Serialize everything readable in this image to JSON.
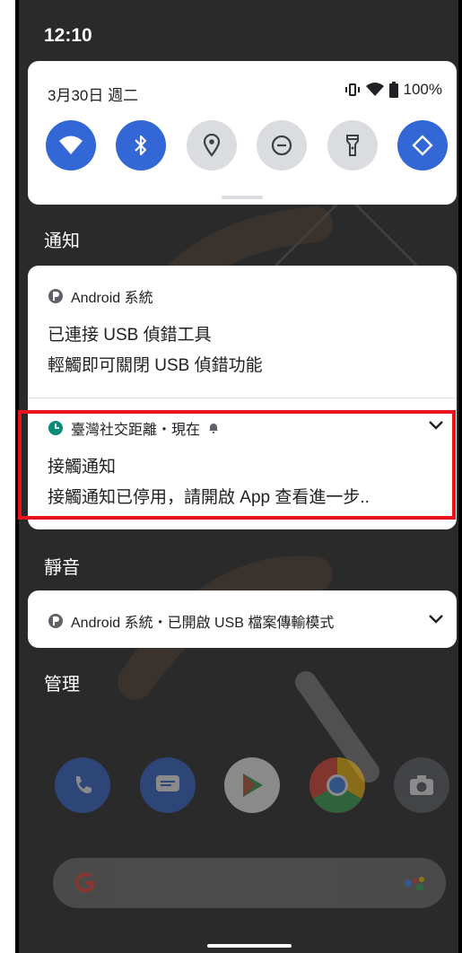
{
  "status_bar": {
    "time": "12:10"
  },
  "quick_settings": {
    "date": "3月30日 週二",
    "battery": "100%",
    "tiles": [
      {
        "icon": "wifi-icon",
        "state": "on"
      },
      {
        "icon": "bluetooth-icon",
        "state": "on"
      },
      {
        "icon": "location-icon",
        "state": "off"
      },
      {
        "icon": "do-not-disturb-icon",
        "state": "off"
      },
      {
        "icon": "flashlight-icon",
        "state": "off"
      },
      {
        "icon": "auto-rotate-icon",
        "state": "on"
      }
    ]
  },
  "sections": {
    "notifications": "通知",
    "silent": "靜音",
    "manage": "管理"
  },
  "notifications": [
    {
      "app": "Android 系統",
      "title": "已連接 USB 偵錯工具",
      "text": "輕觸即可關閉 USB 偵錯功能"
    },
    {
      "app": "臺灣社交距離・現在",
      "title": "接觸通知",
      "text": "接觸通知已停用，請開啟 App 查看進一步.."
    }
  ],
  "silent_notification": {
    "app": "Android 系統・已開啟 USB 檔案傳輸模式"
  },
  "colors": {
    "accent": "#3367d6",
    "highlight": "#e8131b",
    "background": "#2a2a2a"
  }
}
